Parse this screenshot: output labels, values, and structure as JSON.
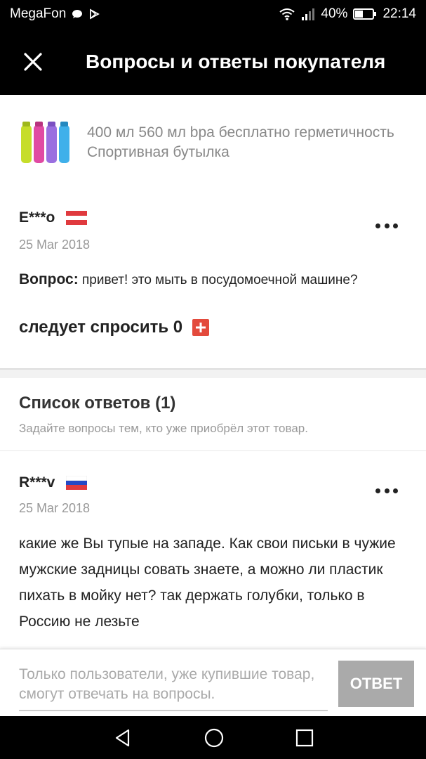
{
  "status_bar": {
    "carrier": "MegaFon",
    "battery": "40%",
    "time": "22:14"
  },
  "header": {
    "title": "Вопросы и ответы покупателя"
  },
  "product": {
    "name": "400 мл 560 мл bpa бесплатно герметичность Спортивная бутылка"
  },
  "question": {
    "user": "E***o",
    "date": "25 Mar 2018",
    "label": "Вопрос:",
    "text": "привет! это мыть в посудомоечной машине?",
    "ask_label": "следует спросить 0"
  },
  "answers_section": {
    "title": "Список ответов (1)",
    "subtitle": "Задайте вопросы тем, кто уже приобрёл этот товар."
  },
  "answer": {
    "user": "R***v",
    "date": "25 Mar 2018",
    "text": "какие же Вы тупые на западе. Как свои письки в чужие мужские задницы совать знаете, а можно ли пластик пихать в мойку нет? так держать голубки, только в Россию не лезьте"
  },
  "reply_bar": {
    "placeholder": "Только пользователи, уже купившие товар, смогут отвечать на вопросы.",
    "button_label": "ОТВЕТ"
  },
  "colors": {
    "accent": "#e34a3c",
    "button_disabled": "#aaaaaa",
    "bar": "#000000"
  }
}
